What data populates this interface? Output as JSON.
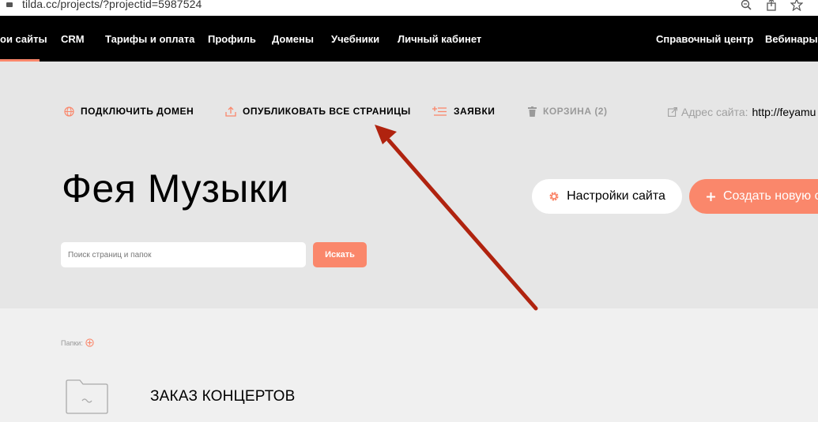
{
  "browser": {
    "url": "tilda.cc/projects/?projectid=5987524",
    "icons": [
      "lock-icon",
      "zoom-icon",
      "share-icon",
      "star-icon"
    ]
  },
  "nav": {
    "items": [
      "ои сайты",
      "CRM",
      "Тарифы и оплата",
      "Профиль",
      "Домены",
      "Учебники",
      "Личный кабинет"
    ],
    "right": [
      "Справочный центр",
      "Вебинары"
    ]
  },
  "actions": {
    "connect_domain": "ПОДКЛЮЧИТЬ ДОМЕН",
    "publish_all": "ОПУБЛИКОВАТЬ ВСЕ СТРАНИЦЫ",
    "requests": "ЗАЯВКИ",
    "trash": "КОРЗИНА (2)"
  },
  "site_address": {
    "label": "Адрес сайта:",
    "value": "http://feyamu"
  },
  "project": {
    "title": "Фея Музыки"
  },
  "buttons": {
    "settings": "Настройки сайта",
    "create": "Создать новую с"
  },
  "search": {
    "placeholder": "Поиск страниц и папок",
    "button": "Искать"
  },
  "folders": {
    "label": "Папки:",
    "items": [
      {
        "name": "ЗАКАЗ КОНЦЕРТОВ"
      }
    ]
  },
  "colors": {
    "accent": "#fa876b",
    "nav_bg": "#000000",
    "header_bg": "#e6e6e6",
    "content_bg": "#f0f0f0",
    "annotation_arrow": "#b0230f"
  }
}
